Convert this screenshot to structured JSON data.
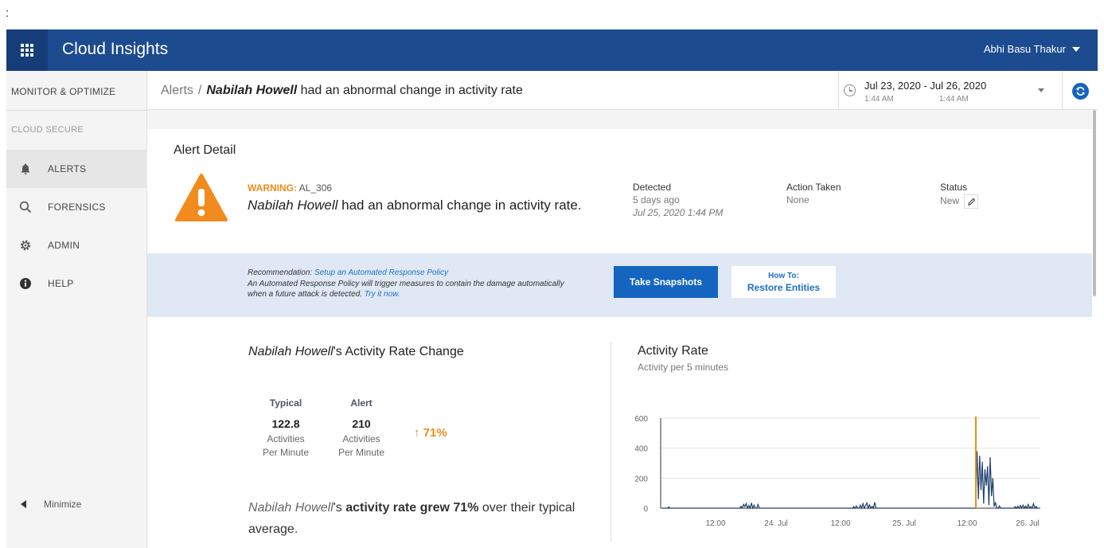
{
  "corner_char": ":",
  "app": {
    "title": "Cloud Insights",
    "user": "Abhi Basu Thakur"
  },
  "sidebar": {
    "section": "MONITOR & OPTIMIZE",
    "subsection": "CLOUD SECURE",
    "items": [
      {
        "label": "ALERTS",
        "icon": "bell-icon",
        "active": true
      },
      {
        "label": "FORENSICS",
        "icon": "search-icon",
        "active": false
      },
      {
        "label": "ADMIN",
        "icon": "gear-icon",
        "active": false
      },
      {
        "label": "HELP",
        "icon": "info-icon",
        "active": false
      }
    ],
    "minimize": "Minimize"
  },
  "header": {
    "crumb_root": "Alerts",
    "crumb_sep": "/",
    "crumb_name": "Nabilah Howell",
    "crumb_rest": " had an abnormal change in activity rate",
    "date_range": "Jul 23, 2020 - Jul 26, 2020",
    "time_start": "1:44 AM",
    "time_end": "1:44 AM"
  },
  "alert": {
    "card_title": "Alert Detail",
    "warning_label": "WARNING:",
    "alert_id": " AL_306",
    "message_name": "Nabilah Howell",
    "message_rest": " had an abnormal change in activity rate.",
    "detected_label": "Detected",
    "detected_ago": "5 days ago",
    "detected_at": "Jul 25, 2020 1:44 PM",
    "action_label": "Action Taken",
    "action_value": "None",
    "status_label": "Status",
    "status_value": "New"
  },
  "recommendation": {
    "prefix": "Recommendation: ",
    "link": "Setup an Automated Response Policy",
    "body": "An Automated Response Policy will trigger measures to contain the damage automatically when a future attack is detected. ",
    "try_link": "Try it now.",
    "snap_button": "Take Snapshots",
    "howto_small": "How To:",
    "howto_main": "Restore Entities"
  },
  "activity": {
    "title_name": "Nabilah Howell",
    "title_rest": "'s Activity Rate Change",
    "typical_label": "Typical",
    "typical_value": "122.8",
    "alert_label": "Alert",
    "alert_value": "210",
    "unit_line1": "Activities",
    "unit_line2": "Per Minute",
    "change_pct": "↑ 71%",
    "summary_name": "Nabilah Howell",
    "summary_mid": "'s ",
    "summary_bold": "activity rate grew 71",
    "summary_pct": "%",
    "summary_end": " over their typical average."
  },
  "colors": {
    "brand": "#1d4b8f",
    "accent": "#1565c0",
    "warning": "#f08c1b",
    "series": "#1f3f6e",
    "marker": "#f08c1b"
  },
  "chart_data": {
    "type": "line",
    "title": "Activity Rate",
    "subtitle": "Activity per 5 minutes",
    "ylim": [
      0,
      600
    ],
    "yticks": [
      0,
      200,
      400,
      600
    ],
    "xticks": [
      "12:00",
      "24. Jul",
      "12:00",
      "25. Jul",
      "12:00",
      "26. Jul"
    ],
    "marker_x_label": "Jul 25, 2020 1:44 PM",
    "series": [
      {
        "values": [
          0,
          0,
          0,
          0,
          0,
          8,
          0,
          0,
          0,
          0,
          0,
          0,
          0,
          0,
          0,
          0,
          0,
          0,
          0,
          0,
          0,
          0,
          0,
          0,
          0,
          0,
          0,
          0,
          0,
          0,
          0,
          0,
          0,
          0,
          0,
          0,
          0,
          0,
          0,
          0,
          0,
          0,
          0,
          0,
          0,
          0,
          0,
          0,
          0,
          0,
          0,
          0,
          0,
          0,
          0,
          0,
          0,
          0,
          0,
          0,
          12,
          0,
          25,
          10,
          30,
          0,
          18,
          0,
          35,
          0,
          20,
          0,
          0,
          25,
          0,
          0,
          0,
          0,
          0,
          0,
          0,
          0,
          0,
          0,
          0,
          0,
          0,
          0,
          0,
          0,
          0,
          0,
          0,
          0,
          0,
          0,
          0,
          0,
          0,
          0,
          0,
          0,
          0,
          0,
          0,
          0,
          0,
          0,
          0,
          0,
          0,
          0,
          0,
          0,
          0,
          0,
          0,
          0,
          0,
          0,
          0,
          0,
          0,
          0,
          0,
          0,
          0,
          0,
          0,
          0,
          0,
          0,
          0,
          0,
          0,
          0,
          0,
          0,
          0,
          0,
          0,
          0,
          0,
          0,
          0,
          0,
          10,
          0,
          15,
          0,
          0,
          20,
          0,
          30,
          0,
          18,
          35,
          0,
          22,
          0,
          12,
          0,
          40,
          0,
          0,
          0,
          0,
          0,
          0,
          0,
          0,
          0,
          0,
          0,
          0,
          0,
          0,
          0,
          0,
          0,
          0,
          0,
          0,
          0,
          0,
          0,
          0,
          0,
          0,
          0,
          0,
          0,
          0,
          0,
          0,
          0,
          0,
          0,
          0,
          0,
          0,
          0,
          0,
          0,
          0,
          0,
          0,
          0,
          0,
          0,
          0,
          0,
          0,
          0,
          0,
          0,
          0,
          0,
          0,
          0,
          0,
          0,
          0,
          0,
          0,
          0,
          0,
          0,
          0,
          0,
          0,
          0,
          0,
          0,
          0,
          0,
          0,
          0,
          0,
          0,
          380,
          60,
          350,
          120,
          310,
          30,
          260,
          150,
          280,
          20,
          340,
          80,
          200,
          10,
          40,
          0,
          0,
          15,
          0,
          0,
          0,
          0,
          0,
          0,
          0,
          0,
          0,
          0,
          0,
          10,
          0,
          12,
          0,
          18,
          0,
          20,
          0,
          14,
          0,
          25,
          0,
          10,
          0,
          30,
          0,
          12,
          0,
          0
        ]
      }
    ]
  }
}
